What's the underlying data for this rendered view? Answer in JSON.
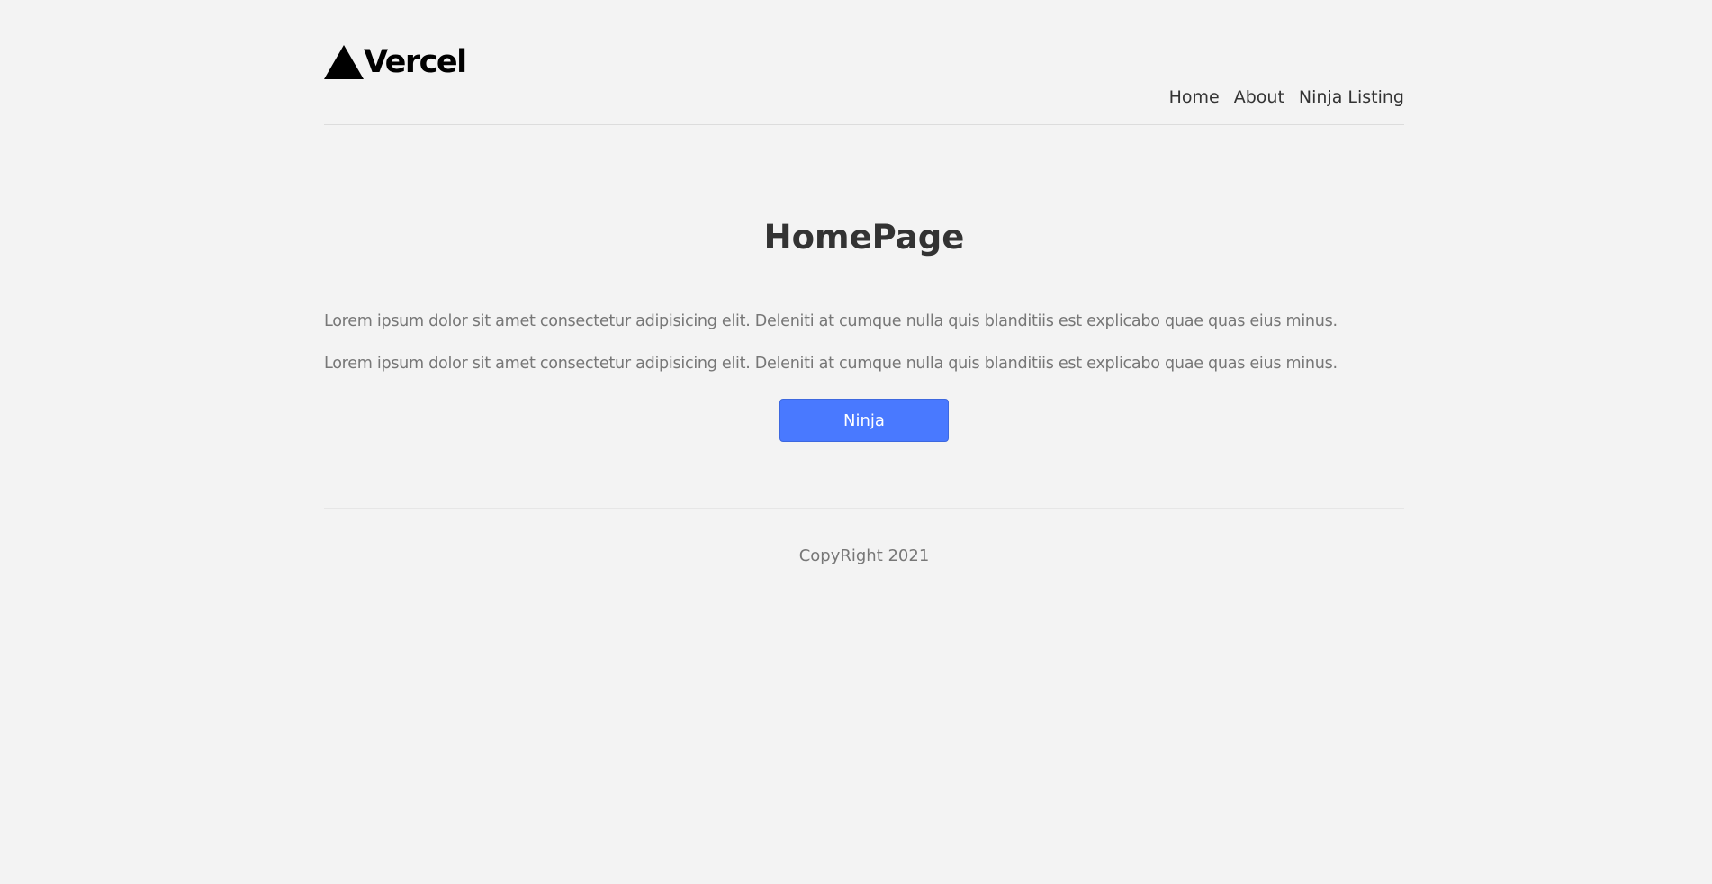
{
  "header": {
    "logo_text": "Vercel",
    "logo_icon": "triangle-logo-icon",
    "nav": [
      {
        "label": "Home"
      },
      {
        "label": "About"
      },
      {
        "label": "Ninja Listing"
      }
    ]
  },
  "main": {
    "title": "HomePage",
    "paragraphs": [
      "Lorem ipsum dolor sit amet consectetur adipisicing elit. Deleniti at cumque nulla quis blanditiis est explicabo quae quas eius minus.",
      "Lorem ipsum dolor sit amet consectetur adipisicing elit. Deleniti at cumque nulla quis blanditiis est explicabo quae quas eius minus."
    ],
    "button_label": "Ninja"
  },
  "footer": {
    "copyright": "CopyRight 2021"
  },
  "colors": {
    "background": "#f3f3f3",
    "button": "#4979ff",
    "heading": "#333333",
    "body_text": "#777777"
  }
}
